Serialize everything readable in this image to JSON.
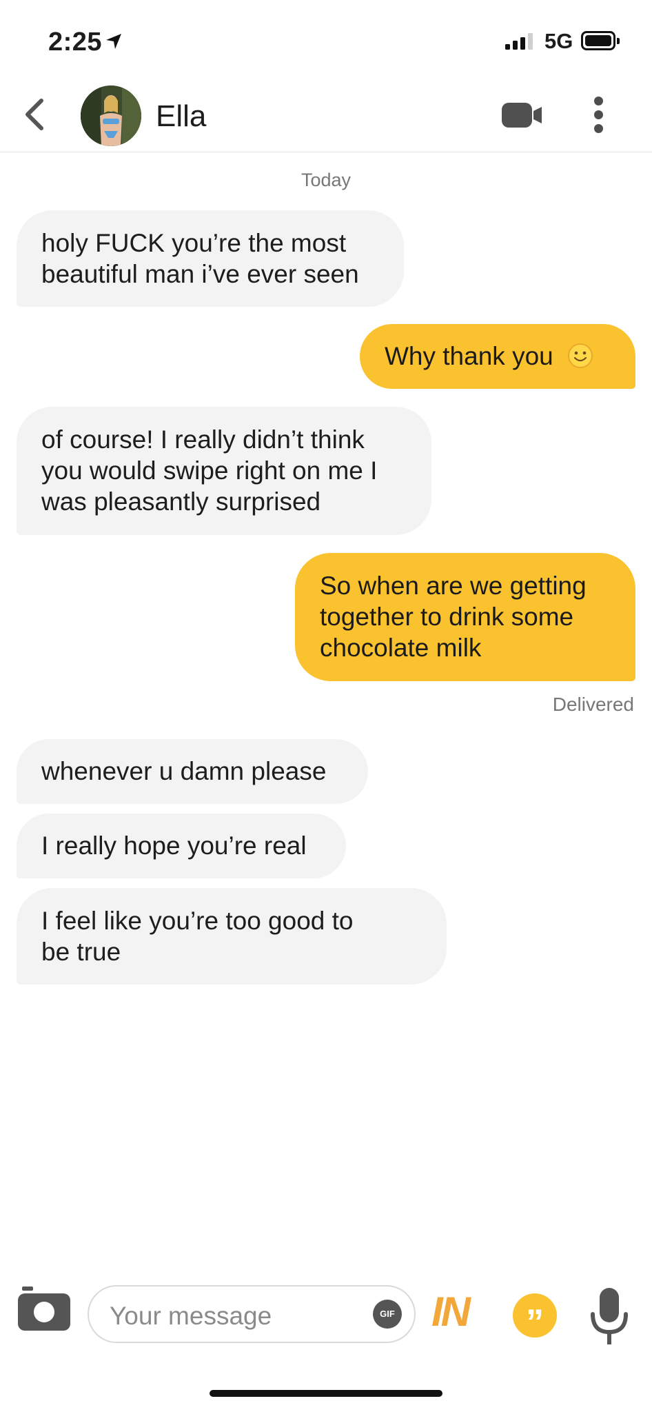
{
  "status": {
    "time": "2:25",
    "network": "5G"
  },
  "header": {
    "name": "Ella"
  },
  "day_label": "Today",
  "messages": [
    {
      "from": "them",
      "lines": [
        "holy FUCK you’re the most",
        "beautiful man i’ve ever seen"
      ]
    },
    {
      "from": "me",
      "lines": [
        "Why thank you"
      ],
      "emoji": "🙂"
    },
    {
      "from": "them",
      "lines": [
        "of course! I really didn’t think",
        "you would swipe right on me I",
        "was pleasantly surprised"
      ]
    },
    {
      "from": "me",
      "lines": [
        "So when are we getting",
        "together to drink some",
        "chocolate milk"
      ]
    },
    {
      "from": "them",
      "lines": [
        "whenever u damn please"
      ]
    },
    {
      "from": "them",
      "lines": [
        "I really hope you’re real"
      ]
    },
    {
      "from": "them",
      "lines": [
        "I feel like you’re too good to",
        "be true"
      ]
    }
  ],
  "delivered_label": "Delivered",
  "composer": {
    "placeholder": "Your message",
    "gif_label": "GIF",
    "badge_label": "IN",
    "quote_glyph": "”"
  },
  "colors": {
    "accent": "#fbc22f",
    "incoming_bubble": "#f3f3f3"
  },
  "icons": [
    "location-arrow-icon",
    "signal-icon",
    "battery-icon",
    "back-chevron-icon",
    "video-call-icon",
    "more-options-icon",
    "camera-icon",
    "gif-icon",
    "quote-icon",
    "microphone-icon"
  ]
}
